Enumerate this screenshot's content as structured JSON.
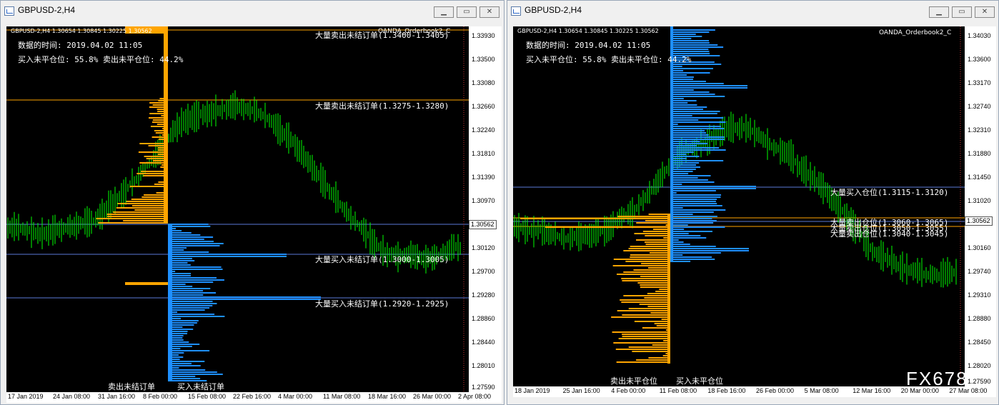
{
  "windows": [
    {
      "title": "GBPUSD-2,H4",
      "info_line": "GBPUSD-2,H4  1.30654 1.30845 1.30225 1.30562",
      "indicator": "OANDA_Orderbook2_C",
      "time_label": "数据的时间: 2019.04.02 11:05",
      "ratio_label": "买入未平仓位: 55.8%  卖出未平仓位: 44.2%",
      "price": "1.30562",
      "y_ticks": [
        "1.33930",
        "1.33500",
        "1.33080",
        "1.32660",
        "1.32240",
        "1.31810",
        "1.31390",
        "1.30970",
        "1.30120",
        "1.29700",
        "1.29280",
        "1.28860",
        "1.28440",
        "1.28010",
        "1.27590"
      ],
      "x_ticks": [
        "17 Jan 2019",
        "24 Jan 08:00",
        "31 Jan 16:00",
        "8 Feb 00:00",
        "15 Feb 08:00",
        "22 Feb 16:00",
        "4 Mar 00:00",
        "11 Mar 08:00",
        "18 Mar 16:00",
        "26 Mar 00:00",
        "2 Apr 08:00"
      ],
      "annotations": [
        "大量卖出未结订单(1.3400-1.3405)",
        "大量卖出未结订单(1.3275-1.3280)",
        "大量买入未结订单(1.3000-1.3005)",
        "大量买入未结订单(1.2920-1.2925)"
      ],
      "bottom_left": "卖出未结订单",
      "bottom_right": "买入未结订单"
    },
    {
      "title": "GBPUSD-2,H4",
      "info_line": "GBPUSD-2,H4  1.30654 1.30845 1.30225 1.30562",
      "indicator": "OANDA_Orderbook2_C",
      "time_label": "数据的时间: 2019.04.02 11:05",
      "ratio_label": "买入未平仓位: 55.8%  卖出未平仓位: 44.2%",
      "price": "1.30562",
      "y_ticks": [
        "1.34030",
        "1.33600",
        "1.33170",
        "1.32740",
        "1.32310",
        "1.31880",
        "1.31450",
        "1.31020",
        "1.30160",
        "1.29740",
        "1.29310",
        "1.28880",
        "1.28450",
        "1.28020",
        "1.27590"
      ],
      "x_ticks": [
        "18 Jan 2019",
        "25 Jan 16:00",
        "4 Feb 00:00",
        "11 Feb 08:00",
        "18 Feb 16:00",
        "26 Feb 00:00",
        "5 Mar 08:00",
        "12 Mar 16:00",
        "20 Mar 00:00",
        "27 Mar 08:00"
      ],
      "annotations": [
        "大量买入仓位(1.3115-1.3120)",
        "大量卖出仓位(1.3060-1.3065)",
        "大量卖出仓位(1.3050-1.3055)",
        "大量卖出仓位(1.3040-1.3045)"
      ],
      "bottom_left": "卖出未平仓位",
      "bottom_right": "买入未平仓位"
    }
  ],
  "watermark": "FX678",
  "colors": {
    "candle": "#00ff00",
    "sell": "#ffa500",
    "buy": "#1e90ff"
  }
}
